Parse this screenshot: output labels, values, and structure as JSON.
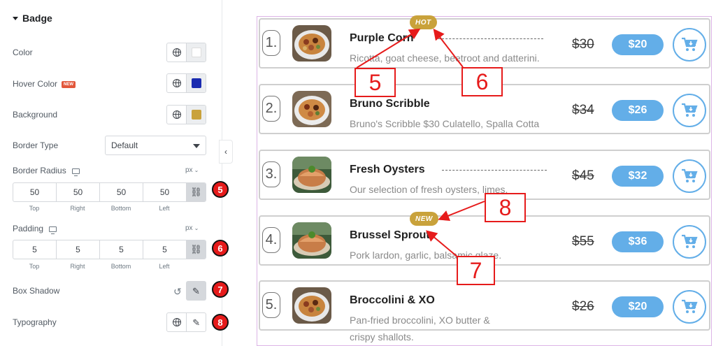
{
  "panel": {
    "section_title": "Badge",
    "color_label": "Color",
    "hover_color_label": "Hover Color",
    "new_tag": "NEW",
    "background_label": "Background",
    "border_type_label": "Border Type",
    "border_type_value": "Default",
    "border_radius_label": "Border Radius",
    "border_radius_unit": "px",
    "border_radius": [
      "50",
      "50",
      "50",
      "50"
    ],
    "padding_label": "Padding",
    "padding_unit": "px",
    "padding": [
      "5",
      "5",
      "5",
      "5"
    ],
    "dim_labels": [
      "Top",
      "Right",
      "Bottom",
      "Left"
    ],
    "box_shadow_label": "Box Shadow",
    "typography_label": "Typography",
    "colors": {
      "color": "#f0f0f0",
      "hover_color": "#1a2bb0",
      "background": "#c9a23b"
    }
  },
  "steps": [
    "5",
    "6",
    "7",
    "8"
  ],
  "menu": {
    "items": [
      {
        "num": "1.",
        "title": "Purple Corn",
        "desc": "Ricotta, goat cheese, beetroot and datterini.",
        "old_price": "$30",
        "price": "$20",
        "badge": "HOT"
      },
      {
        "num": "2.",
        "title": "Bruno Scribble",
        "desc": "Bruno's Scribble $30 Culatello, Spalla Cotta",
        "old_price": "$34",
        "price": "$26"
      },
      {
        "num": "3.",
        "title": "Fresh Oysters",
        "desc": "Our selection of fresh oysters, limes.",
        "old_price": "$45",
        "price": "$32"
      },
      {
        "num": "4.",
        "title": "Brussel Sprout",
        "desc": "Pork lardon, garlic, balsamic glaze.",
        "old_price": "$55",
        "price": "$36",
        "badge": "NEW"
      },
      {
        "num": "5.",
        "title": "Broccolini & XO",
        "desc": "Pan-fried broccolini, XO butter & crispy shallots.",
        "old_price": "$26",
        "price": "$20"
      }
    ]
  },
  "callouts": [
    "5",
    "6",
    "8",
    "7"
  ],
  "icons": [
    "globe-icon",
    "pencil-icon",
    "link-icon",
    "reset-icon",
    "cart-icon",
    "monitor-icon",
    "chevron-left-icon",
    "caret-down-icon"
  ]
}
